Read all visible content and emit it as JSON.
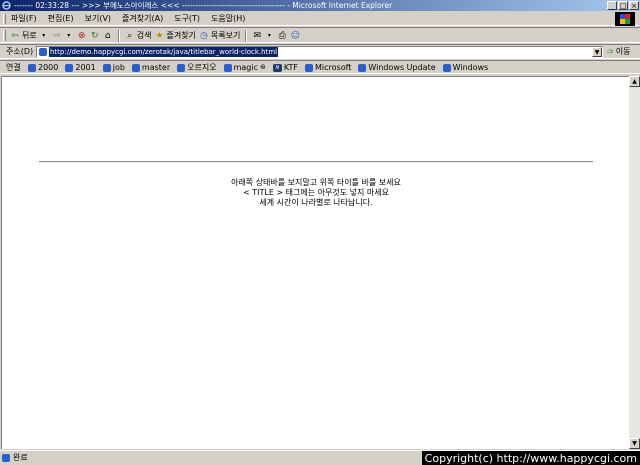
{
  "window": {
    "title": "------- 02:33:28 --- >>> 부에노스아이레스 <<< -------------------------------------- - Microsoft Internet Explorer",
    "controls": [
      "_",
      "□",
      "×"
    ]
  },
  "menu": [
    "파일(F)",
    "편집(E)",
    "보기(V)",
    "즐겨찾기(A)",
    "도구(T)",
    "도움말(H)"
  ],
  "toolbar": {
    "back": "뒤로",
    "search": "검색",
    "favorites": "즐겨찾기",
    "history": "목록보기"
  },
  "address": {
    "label": "주소(D)",
    "url": "http://demo.happycgi.com/zerotak/java/titlebar_world-clock.html",
    "go": "이동"
  },
  "links": {
    "label": "연결",
    "items": [
      "2000",
      "2001",
      "job",
      "master",
      "오르지오",
      "magic",
      "KTF",
      "Microsoft",
      "Windows Update",
      "Windows"
    ]
  },
  "page": {
    "lines": [
      "아래쪽 상태바를 보지말고 위쪽 타이틀 바를 보세요",
      "< TITLE > 태그에는 아무것도 넣지 마세요",
      "세계 시간이 나라별로 나타납니다."
    ]
  },
  "status": {
    "text": "완료",
    "copyright": "Copyright(c) http://www.happycgi.com"
  }
}
